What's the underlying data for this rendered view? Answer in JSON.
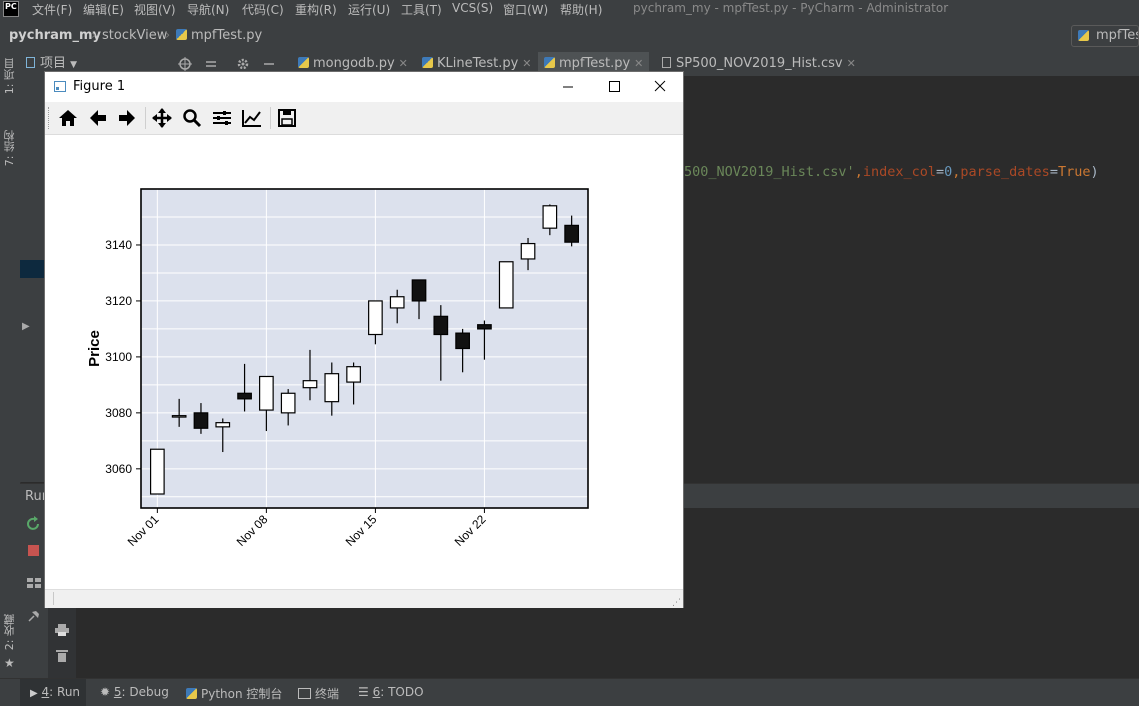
{
  "menubar": {
    "logo": "PC",
    "items": [
      "文件(F)",
      "编辑(E)",
      "视图(V)",
      "导航(N)",
      "代码(C)",
      "重构(R)",
      "运行(U)",
      "工具(T)",
      "VCS(S)",
      "窗口(W)",
      "帮助(H)"
    ],
    "window_title": "pychram_my - mpfTest.py - PyCharm - Administrator"
  },
  "navbar": {
    "project": "pychram_my",
    "folder": "stockView",
    "file": "mpfTest.py",
    "run_config": "mpfTest"
  },
  "tabbar": {
    "project_label": "项目",
    "tabs": [
      {
        "label": "mongodb.py"
      },
      {
        "label": "KLineTest.py"
      },
      {
        "label": "mpfTest.py"
      },
      {
        "label": "SP500_NOV2019_Hist.csv"
      }
    ]
  },
  "left_strip": {
    "project": "1: 项目",
    "structure": "7: 结构",
    "favorites": "2: 收藏"
  },
  "editor": {
    "code_visible": "500_NOV2019_Hist.csv',index_col=0,parse_dates=True)",
    "code_parts": {
      "string": "500_NOV2019_Hist.csv'",
      "comma1": ",",
      "kw1": "index_col",
      "eq1": "=",
      "num": "0",
      "comma2": ",",
      "kw2": "parse_dates",
      "eq2": "=",
      "val": "True",
      "paren": ")"
    }
  },
  "run_panel": {
    "label": "Run"
  },
  "statusbar": {
    "run": {
      "num": "4",
      "rest": ": Run"
    },
    "debug": {
      "num": "5",
      "rest": ": Debug"
    },
    "console": "Python 控制台",
    "terminal": "终端",
    "todo": {
      "num": "6",
      "rest": ": TODO"
    }
  },
  "figure": {
    "title": "Figure 1",
    "toolbar": [
      "home-icon",
      "back-arrow-icon",
      "forward-arrow-icon",
      "pan-icon",
      "zoom-icon",
      "subplots-icon",
      "edit-axes-icon",
      "save-icon"
    ]
  },
  "chart_data": {
    "type": "candlestick",
    "title": "",
    "xlabel": "",
    "ylabel": "Price",
    "ylim": [
      3046,
      3160
    ],
    "yticks": [
      3060,
      3080,
      3100,
      3120,
      3140
    ],
    "xticks": [
      {
        "label": "Nov 01",
        "index": 0
      },
      {
        "label": "Nov 08",
        "index": 5
      },
      {
        "label": "Nov 15",
        "index": 10
      },
      {
        "label": "Nov 22",
        "index": 15
      }
    ],
    "grid": true,
    "colors": {
      "up": "#ffffff",
      "down": "#111111",
      "edge": "#000000",
      "background": "#dce1ed",
      "grid": "#ffffff"
    },
    "candles": [
      {
        "date": "2019-11-01",
        "open": 3051,
        "high": 3067,
        "low": 3051,
        "close": 3067
      },
      {
        "date": "2019-11-04",
        "open": 3078.5,
        "high": 3085,
        "low": 3075,
        "close": 3079
      },
      {
        "date": "2019-11-05",
        "open": 3080,
        "high": 3083.5,
        "low": 3072.5,
        "close": 3074.5
      },
      {
        "date": "2019-11-06",
        "open": 3075,
        "high": 3078,
        "low": 3066,
        "close": 3076.5
      },
      {
        "date": "2019-11-07",
        "open": 3087,
        "high": 3097.5,
        "low": 3080.5,
        "close": 3085
      },
      {
        "date": "2019-11-08",
        "open": 3081,
        "high": 3093,
        "low": 3073.5,
        "close": 3093
      },
      {
        "date": "2019-11-11",
        "open": 3080,
        "high": 3088.5,
        "low": 3075.5,
        "close": 3087
      },
      {
        "date": "2019-11-12",
        "open": 3089,
        "high": 3102.5,
        "low": 3084.5,
        "close": 3091.5
      },
      {
        "date": "2019-11-13",
        "open": 3084,
        "high": 3098,
        "low": 3079,
        "close": 3094
      },
      {
        "date": "2019-11-14",
        "open": 3091,
        "high": 3098,
        "low": 3083,
        "close": 3096.5
      },
      {
        "date": "2019-11-15",
        "open": 3108,
        "high": 3120,
        "low": 3104.5,
        "close": 3120
      },
      {
        "date": "2019-11-18",
        "open": 3117.5,
        "high": 3124,
        "low": 3112,
        "close": 3121.5
      },
      {
        "date": "2019-11-19",
        "open": 3127.5,
        "high": 3127.5,
        "low": 3113.5,
        "close": 3120
      },
      {
        "date": "2019-11-20",
        "open": 3114.5,
        "high": 3118.5,
        "low": 3091.5,
        "close": 3108
      },
      {
        "date": "2019-11-21",
        "open": 3108.5,
        "high": 3110,
        "low": 3094.5,
        "close": 3103
      },
      {
        "date": "2019-11-22",
        "open": 3111.5,
        "high": 3113,
        "low": 3099,
        "close": 3110
      },
      {
        "date": "2019-11-25",
        "open": 3117.5,
        "high": 3134,
        "low": 3117.5,
        "close": 3134
      },
      {
        "date": "2019-11-26",
        "open": 3135,
        "high": 3142.5,
        "low": 3131,
        "close": 3140.5
      },
      {
        "date": "2019-11-27",
        "open": 3146,
        "high": 3154.5,
        "low": 3143.5,
        "close": 3154
      },
      {
        "date": "2019-11-29",
        "open": 3147,
        "high": 3150.5,
        "low": 3139.5,
        "close": 3141
      }
    ]
  }
}
